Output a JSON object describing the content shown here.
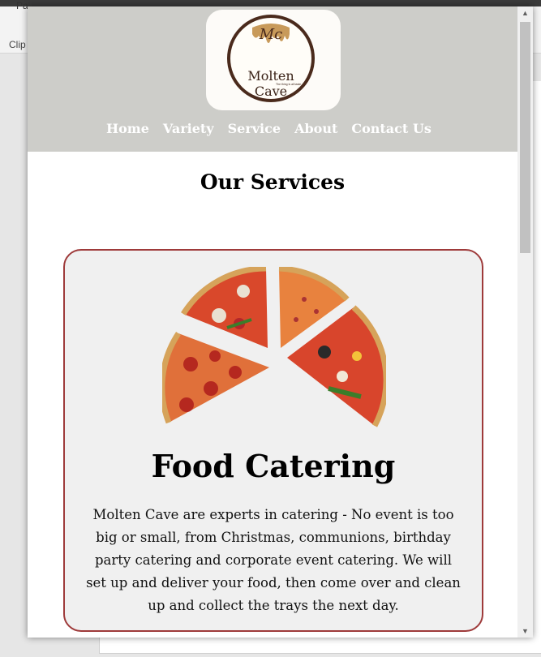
{
  "background_window": {
    "ribbon_label": "Pa",
    "clipboard_label": "Clip"
  },
  "logo": {
    "brand": "Molten Cave",
    "tagline": "The thing is all taste"
  },
  "nav": {
    "items": [
      "Home",
      "Variety",
      "Service",
      "About",
      "Contact Us"
    ]
  },
  "main": {
    "section_title": "Our Services",
    "card": {
      "title": "Food Catering",
      "description": "Molten Cave are experts in catering - No event is too big or small, from Christmas, communions, birthday party catering and corporate event catering. We will set up and deliver your food, then come over and clean up and collect the trays the next day."
    }
  },
  "colors": {
    "header_bg": "#cdcdc9",
    "card_border": "#9e3a3a",
    "card_bg": "#f0f0f0",
    "logo_brown": "#4a2a1c"
  }
}
